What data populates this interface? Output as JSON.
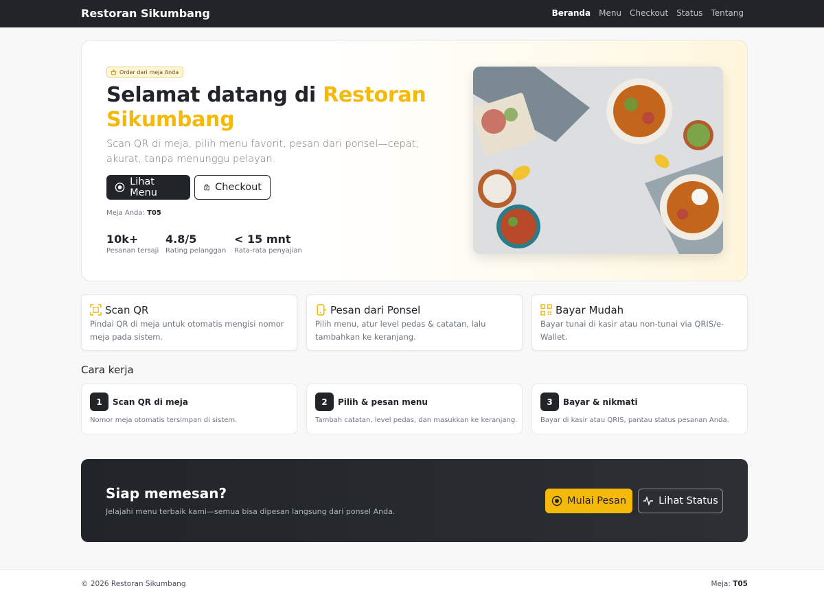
{
  "navbar": {
    "brand": "Restoran Sikumbang",
    "links": [
      {
        "label": "Beranda",
        "active": true
      },
      {
        "label": "Menu"
      },
      {
        "label": "Checkout"
      },
      {
        "label": "Status"
      },
      {
        "label": "Tentang"
      }
    ]
  },
  "hero": {
    "badge": "Order dari meja Anda",
    "title_prefix": "Selamat datang di",
    "title_accent": "Restoran Sikumbang",
    "subtitle": "Scan QR di meja, pilih menu favorit, pesan dari ponsel—cepat, akurat, tanpa menunggu pelayan.",
    "primary_button": "Lihat Menu",
    "secondary_button": "Checkout",
    "table_label": "Meja Anda:",
    "table_value": "T05",
    "stats": [
      {
        "value": "10k+",
        "label": "Pesanan tersaji"
      },
      {
        "value": "4.8/5",
        "label": "Rating pelanggan"
      },
      {
        "value": "< 15 mnt",
        "label": "Rata-rata penyajian"
      }
    ]
  },
  "features": [
    {
      "icon": "qr-scan-icon",
      "title": "Scan QR",
      "desc": "Pindai QR di meja untuk otomatis mengisi nomor meja pada sistem."
    },
    {
      "icon": "phone-icon",
      "title": "Pesan dari Ponsel",
      "desc": "Pilih menu, atur level pedas & catatan, lalu tambahkan ke keranjang."
    },
    {
      "icon": "qr-code-icon",
      "title": "Bayar Mudah",
      "desc": "Bayar tunai di kasir atau non-tunai via QRIS/e-Wallet."
    }
  ],
  "how_it_works": {
    "title": "Cara kerja",
    "steps": [
      {
        "num": "1",
        "title": "Scan QR di meja",
        "desc": "Nomor meja otomatis tersimpan di sistem."
      },
      {
        "num": "2",
        "title": "Pilih & pesan menu",
        "desc": "Tambah catatan, level pedas, dan masukkan ke keranjang."
      },
      {
        "num": "3",
        "title": "Bayar & nikmati",
        "desc": "Bayar di kasir atau QRIS, pantau status pesanan Anda."
      }
    ]
  },
  "cta": {
    "title": "Siap memesan?",
    "desc": "Jelajahi menu terbaik kami—semua bisa dipesan langsung dari ponsel Anda.",
    "primary": "Mulai Pesan",
    "secondary": "Lihat Status"
  },
  "footer": {
    "copyright": "© 2026 Restoran Sikumbang",
    "table_label": "Meja:",
    "table_value": "T05"
  },
  "colors": {
    "dark": "#212529",
    "accent": "#f5b90a",
    "muted": "#6c757d"
  }
}
